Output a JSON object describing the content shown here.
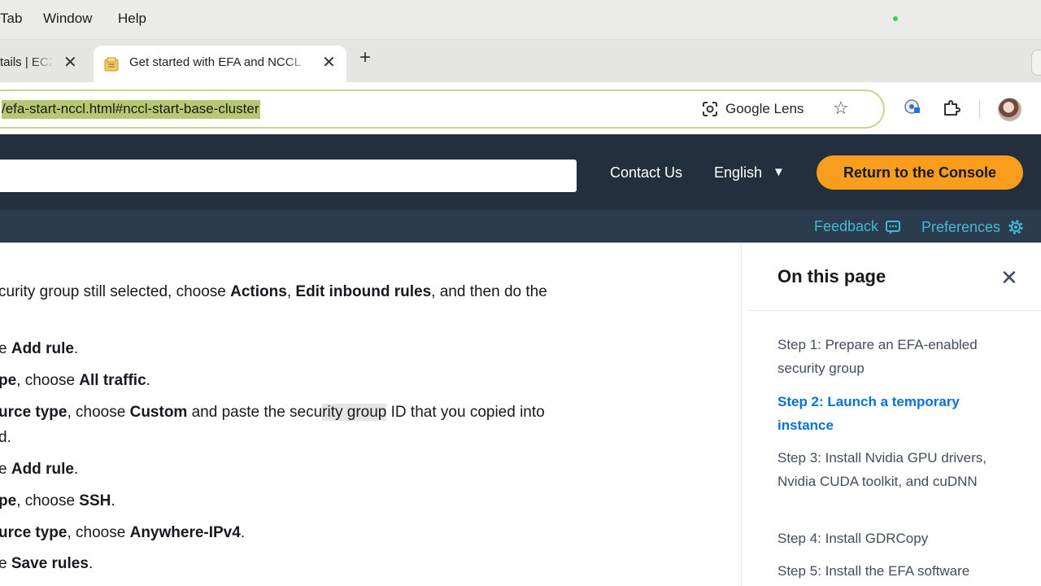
{
  "menubar": {
    "items": [
      "Tab",
      "Window",
      "Help"
    ]
  },
  "tabs": [
    {
      "title": "tails | EC2",
      "active": false
    },
    {
      "title": "Get started with EFA and NCCL",
      "active": true
    }
  ],
  "address_bar": {
    "url": "/efa-start-nccl.html#nccl-start-base-cluster",
    "lens_label": "Google Lens"
  },
  "header": {
    "contact": "Contact Us",
    "language": "English",
    "console_button": "Return to the Console",
    "feedback": "Feedback",
    "preferences": "Preferences"
  },
  "content": {
    "lines": [
      {
        "parts": [
          {
            "t": "curity group still selected, choose "
          },
          {
            "t": "Actions",
            "b": true
          },
          {
            "t": ", "
          },
          {
            "t": "Edit inbound rules",
            "b": true
          },
          {
            "t": ", and then do the"
          }
        ]
      },
      {
        "parts": [
          {
            "t": "e "
          },
          {
            "t": "Add rule",
            "b": true
          },
          {
            "t": "."
          }
        ]
      },
      {
        "parts": [
          {
            "t": "pe",
            "b": true
          },
          {
            "t": ", choose "
          },
          {
            "t": "All traffic",
            "b": true
          },
          {
            "t": "."
          }
        ]
      },
      {
        "parts": [
          {
            "t": "urce type",
            "b": true
          },
          {
            "t": ", choose "
          },
          {
            "t": "Custom",
            "b": true
          },
          {
            "t": " and paste the secu"
          },
          {
            "t": "rity group",
            "hl": true
          },
          {
            "t": " ID that you copied into"
          }
        ]
      },
      {
        "parts": [
          {
            "t": "d."
          }
        ]
      },
      {
        "parts": [
          {
            "t": "e "
          },
          {
            "t": "Add rule",
            "b": true
          },
          {
            "t": "."
          }
        ]
      },
      {
        "parts": [
          {
            "t": "pe",
            "b": true
          },
          {
            "t": ", choose "
          },
          {
            "t": "SSH",
            "b": true
          },
          {
            "t": "."
          }
        ]
      },
      {
        "parts": [
          {
            "t": "urce type",
            "b": true
          },
          {
            "t": ", choose "
          },
          {
            "t": "Anywhere-IPv4",
            "b": true
          },
          {
            "t": "."
          }
        ]
      },
      {
        "parts": [
          {
            "t": "e "
          },
          {
            "t": "Save rules",
            "b": true
          },
          {
            "t": "."
          }
        ]
      }
    ]
  },
  "panel": {
    "title": "On this page",
    "items": [
      {
        "label": "Step 1: Prepare an EFA-enabled security group",
        "active": false
      },
      {
        "label": "Step 2: Launch a temporary instance",
        "active": true
      },
      {
        "label": "Step 3: Install Nvidia GPU drivers, Nvidia CUDA toolkit, and cuDNN",
        "active": false
      },
      {
        "label": "Step 4: Install GDRCopy",
        "active": false
      },
      {
        "label": "Step 5: Install the EFA software",
        "active": false
      }
    ]
  },
  "colors": {
    "aws_header": "#232f3e",
    "console_button": "#f89e1c",
    "link_active": "#0972d3",
    "sub_link": "#44b9d6"
  }
}
